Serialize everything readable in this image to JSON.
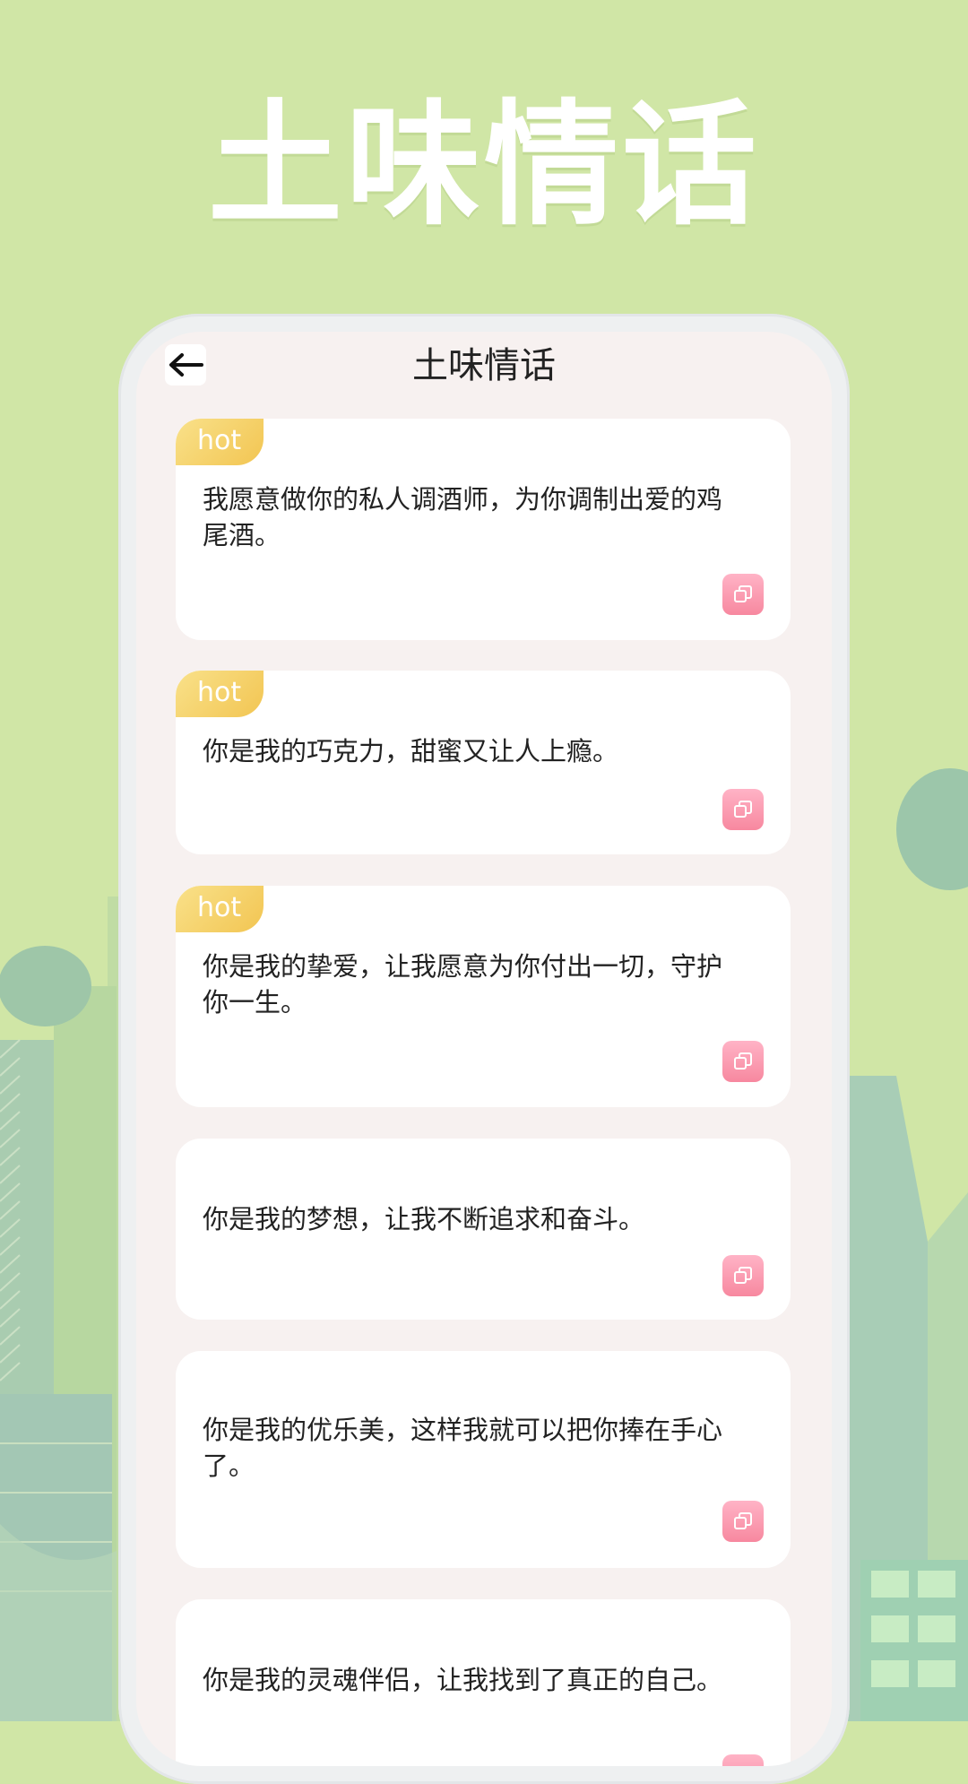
{
  "hero": {
    "title": "土味情话"
  },
  "header": {
    "title": "土味情话",
    "back_icon": "arrow-left-icon"
  },
  "colors": {
    "background": "#d0e6a6",
    "hot_badge": "#f5cf6a",
    "copy_button": "#f98fa8"
  },
  "quotes": [
    {
      "text": "我愿意做你的私人调酒师，为你调制出爱的鸡尾酒。",
      "badge": "hot"
    },
    {
      "text": "你是我的巧克力，甜蜜又让人上瘾。",
      "badge": "hot"
    },
    {
      "text": "你是我的挚爱，让我愿意为你付出一切，守护你一生。",
      "badge": "hot"
    },
    {
      "text": "你是我的梦想，让我不断追求和奋斗。"
    },
    {
      "text": "你是我的优乐美，这样我就可以把你捧在手心了。"
    },
    {
      "text": "你是我的灵魂伴侣，让我找到了真正的自己。"
    }
  ],
  "icons": {
    "copy": "copy-icon"
  }
}
